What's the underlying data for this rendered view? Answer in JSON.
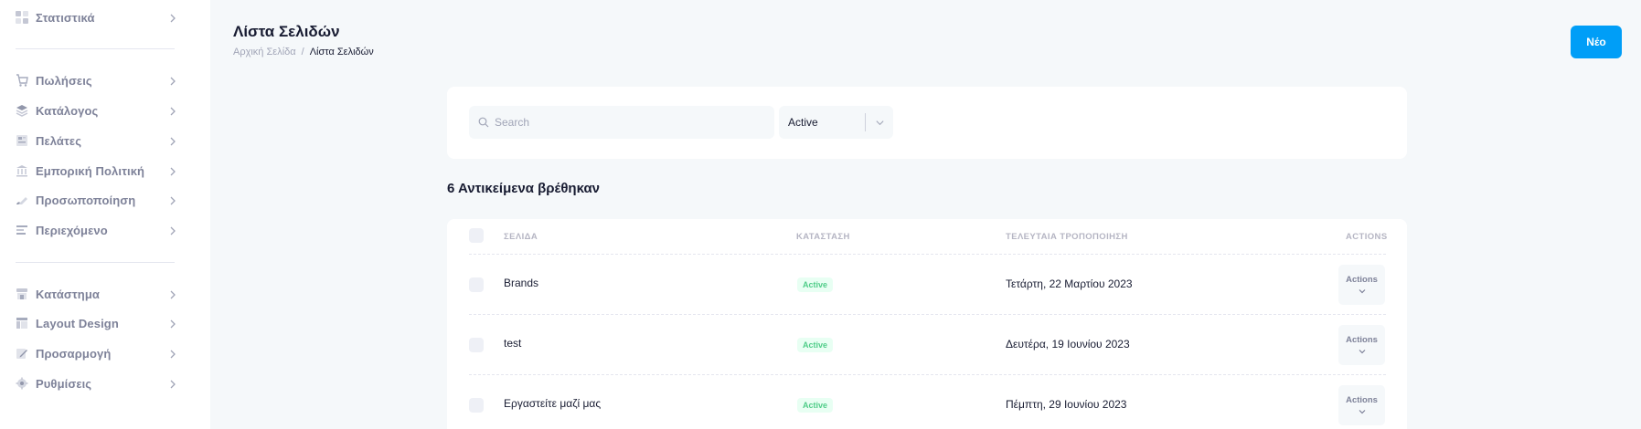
{
  "sidebar": {
    "items": [
      {
        "label": "Στατιστικά",
        "icon": "dashboard-icon"
      },
      {
        "label": "Πωλήσεις",
        "icon": "cart-icon"
      },
      {
        "label": "Κατάλογος",
        "icon": "layers-icon"
      },
      {
        "label": "Πελάτες",
        "icon": "address-book-icon"
      },
      {
        "label": "Εμπορική Πολιτική",
        "icon": "bank-icon"
      },
      {
        "label": "Προσωποποίηση",
        "icon": "brush-icon"
      },
      {
        "label": "Περιεχόμενο",
        "icon": "text-align-icon"
      },
      {
        "label": "Κατάστημα",
        "icon": "store-icon"
      },
      {
        "label": "Layout Design",
        "icon": "layout-icon"
      },
      {
        "label": "Προσαρμογή",
        "icon": "pencil-icon"
      },
      {
        "label": "Ρυθμίσεις",
        "icon": "gear-icon"
      }
    ]
  },
  "header": {
    "title": "Λίστα Σελιδών",
    "breadcrumb": {
      "home": "Αρχική Σελίδα",
      "separator": "/",
      "current": "Λίστα Σελιδών"
    },
    "new_button": "Νέο"
  },
  "filters": {
    "search_placeholder": "Search",
    "status_value": "Active"
  },
  "results": {
    "count_text": "6 Αντικείμενα βρέθηκαν"
  },
  "table": {
    "columns": {
      "page": "ΣΕΛΙΔΑ",
      "status": "ΚΑΤΑΣΤΑΣΗ",
      "modified": "ΤΕΛΕΥΤΑΙΑ ΤΡΟΠΟΠΟΙΗΣΗ",
      "actions": "ACTIONS"
    },
    "rows": [
      {
        "name": "Brands",
        "status": "Active",
        "date": "Τετάρτη, 22 Μαρτίου 2023",
        "action": "Actions"
      },
      {
        "name": "test",
        "status": "Active",
        "date": "Δευτέρα, 19 Ιουνίου 2023",
        "action": "Actions"
      },
      {
        "name": "Εργαστείτε μαζί μας",
        "status": "Active",
        "date": "Πέμπτη, 29 Ιουνίου 2023",
        "action": "Actions"
      }
    ]
  },
  "colors": {
    "accent": "#009ef7",
    "success_text": "#50cd89",
    "success_bg": "#e8fff3",
    "muted": "#7e8299"
  }
}
